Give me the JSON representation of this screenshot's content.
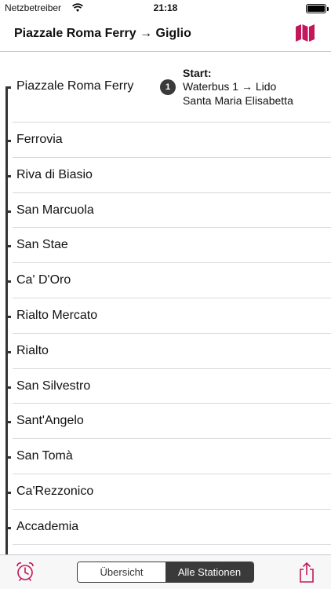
{
  "status_bar": {
    "carrier": "Netzbetreiber",
    "time": "21:18",
    "wifi_icon": "wifi-icon",
    "battery_icon": "battery-icon"
  },
  "nav": {
    "title": "Piazzale Roma Ferry → Giglio",
    "map_icon": "map-icon"
  },
  "accent_color": "#c2185b",
  "start": {
    "badge": "1",
    "label": "Start:",
    "line": "Waterbus 1 → Lido",
    "direction": "Santa Maria Elisabetta"
  },
  "stations": [
    "Piazzale Roma Ferry",
    "Ferrovia",
    "Riva di Biasio",
    "San Marcuola",
    "San Stae",
    "Ca' D'Oro",
    "Rialto Mercato",
    "Rialto",
    "San Silvestro",
    "Sant'Angelo",
    "San Tomà",
    "Ca'Rezzonico",
    "Accademia"
  ],
  "toolbar": {
    "alarm_icon": "alarm-clock-icon",
    "segments": [
      "Übersicht",
      "Alle Stationen"
    ],
    "selected_segment": "Alle Stationen",
    "share_icon": "share-icon"
  }
}
